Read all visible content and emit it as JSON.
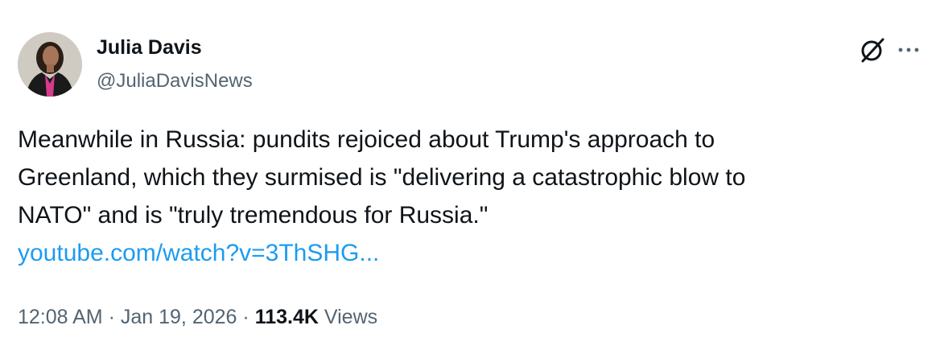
{
  "author": {
    "name": "Julia Davis",
    "handle": "@JuliaDavisNews",
    "avatar_icon": "profile-photo"
  },
  "header_actions": {
    "grok_icon": "grok-icon",
    "more_icon": "more-options-icon"
  },
  "tweet": {
    "text_lines": [
      "Meanwhile in Russia: pundits rejoiced about Trump's approach to",
      "Greenland, which they surmised is \"delivering a catastrophic blow to",
      "NATO\" and is \"truly tremendous for Russia.\""
    ],
    "link": "youtube.com/watch?v=3ThSHG..."
  },
  "meta": {
    "time": "12:08 AM",
    "separator": "·",
    "date": "Jan 19, 2026",
    "views_count": "113.4K",
    "views_label": "Views"
  },
  "colors": {
    "text": "#0f1419",
    "secondary": "#536471",
    "link": "#1d9bf0",
    "background": "#ffffff"
  }
}
